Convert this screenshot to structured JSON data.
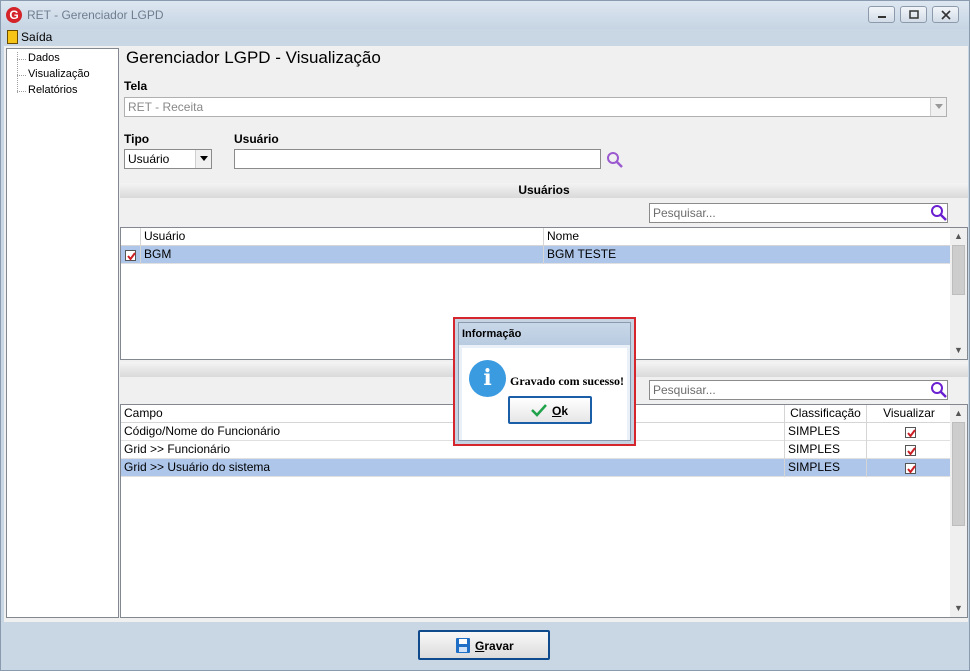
{
  "window": {
    "title": "RET - Gerenciador LGPD",
    "app_icon": "G"
  },
  "menu": {
    "saida": "Saída"
  },
  "tree": {
    "items": [
      {
        "label": "Dados"
      },
      {
        "label": "Visualização"
      },
      {
        "label": "Relatórios"
      }
    ]
  },
  "page": {
    "title": "Gerenciador LGPD - Visualização",
    "tela_label": "Tela",
    "tela_value": "RET - Receita",
    "tipo_label": "Tipo",
    "tipo_value": "Usuário",
    "usuario_label": "Usuário",
    "usuario_value": ""
  },
  "users_section": {
    "header": "Usuários",
    "search_placeholder": "Pesquisar...",
    "columns": [
      "Usuário",
      "Nome"
    ],
    "rows": [
      {
        "checked": true,
        "usuario": "BGM",
        "nome": "BGM TESTE"
      }
    ]
  },
  "fields_section": {
    "search_placeholder": "Pesquisar...",
    "columns": [
      "Campo",
      "Classificação",
      "Visualizar"
    ],
    "rows": [
      {
        "campo": "Código/Nome do Funcionário",
        "classificacao": "SIMPLES",
        "visualizar": true
      },
      {
        "campo": "Grid >> Funcionário",
        "classificacao": "SIMPLES",
        "visualizar": true
      },
      {
        "campo": "Grid >> Usuário do sistema",
        "classificacao": "SIMPLES",
        "visualizar": true
      }
    ]
  },
  "save_button": {
    "label_first": "G",
    "label_rest": "ravar"
  },
  "dialog": {
    "title": "Informação",
    "icon": "i",
    "message": "Gravado com sucesso!",
    "ok_first": "O",
    "ok_rest": "k"
  },
  "colors": {
    "selection": "#aec6ea",
    "check_red": "#cc1f25",
    "search_purple": "#8a2be2",
    "dialog_border": "#d4262c"
  }
}
